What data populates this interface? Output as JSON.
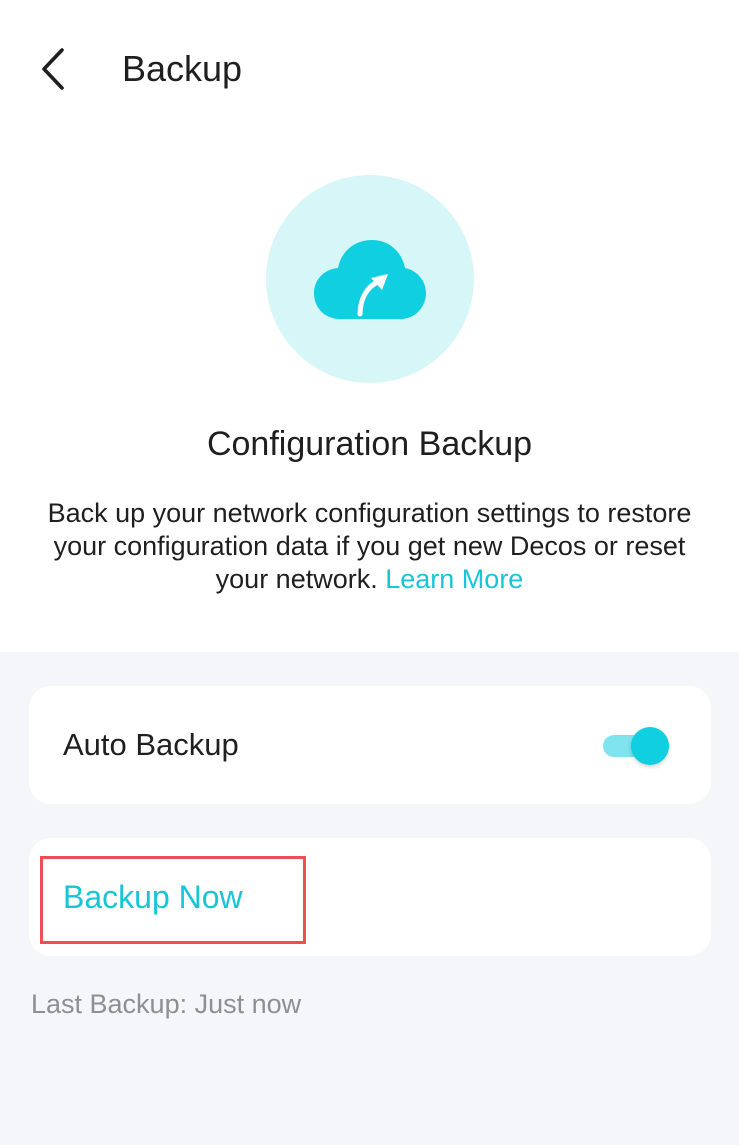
{
  "header": {
    "title": "Backup",
    "back_icon": "chevron-left-icon"
  },
  "hero": {
    "icon": "cloud-upload-icon",
    "circle_color": "#d6f6f8",
    "icon_color": "#0fcfe0",
    "title": "Configuration Backup",
    "description": "Back up your network configuration settings to restore your configuration data if you get new Decos or reset your network.",
    "learn_more_label": "Learn More"
  },
  "settings": {
    "auto_backup_label": "Auto Backup",
    "auto_backup_enabled": true,
    "backup_now_label": "Backup Now",
    "last_backup_text": "Last Backup: Just now"
  },
  "colors": {
    "accent": "#17c5d7",
    "highlight": "#ee4f55",
    "background": "#f5f6fa"
  }
}
